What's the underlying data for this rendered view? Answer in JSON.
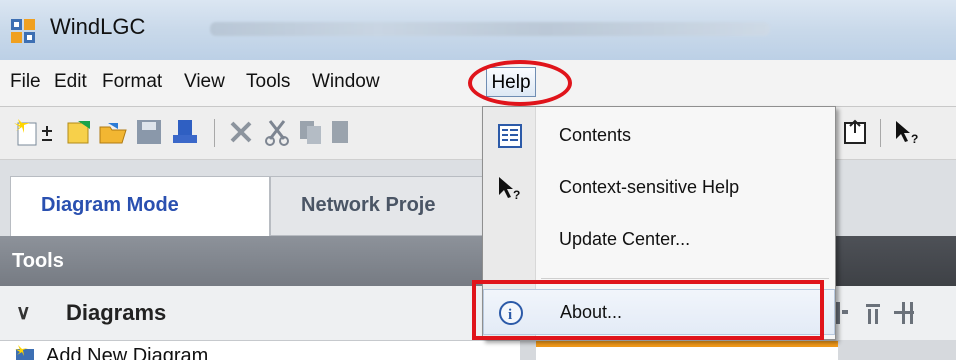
{
  "window": {
    "title": "WindLGC"
  },
  "menubar": {
    "items": [
      "File",
      "Edit",
      "Format",
      "View",
      "Tools",
      "Window",
      "Help"
    ]
  },
  "tabs": [
    {
      "label": "Diagram Mode",
      "active": true
    },
    {
      "label": "Network Proje",
      "active": false
    }
  ],
  "tools_panel": {
    "header": "Tools",
    "section": "Diagrams",
    "first_item": "Add New Diagram"
  },
  "help_menu": {
    "items": [
      {
        "label": "Contents",
        "icon": "contents-icon"
      },
      {
        "label": "Context-sensitive Help",
        "icon": "context-help-icon"
      },
      {
        "label": "Update Center...",
        "icon": ""
      },
      {
        "label": "About...",
        "icon": "info-icon"
      }
    ]
  },
  "colors": {
    "annotation": "#e0141b",
    "active_tab_text": "#2a50b0",
    "accent_orange": "#f39a1a"
  }
}
